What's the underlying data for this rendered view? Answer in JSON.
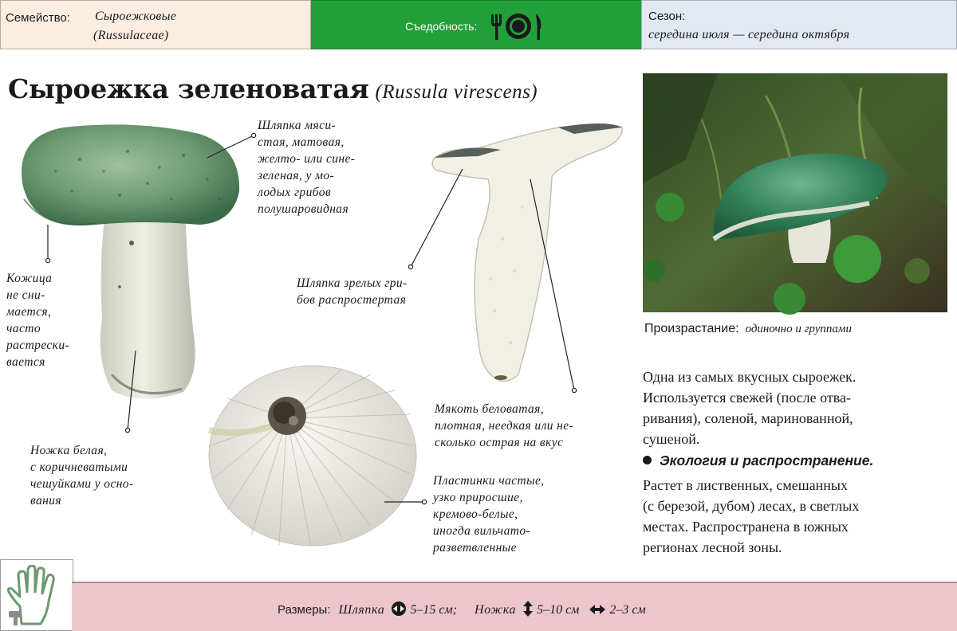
{
  "header": {
    "family_label": "Семейство:",
    "family_ru": "Сыроежковые",
    "family_lat": "(Russulaceae)",
    "edibility_label": "Съедобность:",
    "edibility_icon": "plate-fork-knife-icon",
    "season_label": "Сезон:",
    "season_value": "середина июля — середина октября"
  },
  "title": {
    "name_ru": "Сыроежка зеленоватая",
    "name_lat": "(Russula virescens)"
  },
  "annotations": {
    "cap": [
      "Шляпка мяси-",
      "стая, матовая,",
      "желто- или сине-",
      "зеленая, у мо-",
      "лодых грибов",
      "полушаровидная"
    ],
    "skin": [
      "Кожица",
      "не сни-",
      "мается,",
      "часто",
      "растрески-",
      "вается"
    ],
    "stem": [
      "Ножка белая,",
      "с коричневатыми",
      "чешуйками у осно-",
      "вания"
    ],
    "mature_cap": [
      "Шляпка зрелых гри-",
      "бов распростертая"
    ],
    "flesh": [
      "Мякоть беловатая,",
      "плотная, неедкая или не-",
      "сколько острая на вкус"
    ],
    "gills": [
      "Пластинки частые,",
      "узко приросшие,",
      "кремово-белые,",
      "иногда вильчато-",
      "разветвленные"
    ]
  },
  "habitat": {
    "label": "Произрастание:",
    "value": "одиночно и группами"
  },
  "description": [
    "Одна из самых вкусных сыроежек.",
    "Используется свежей (после отва-",
    "ривания), соленой, маринованной,",
    "сушеной."
  ],
  "ecology": {
    "heading": "Экология и распространение.",
    "text": [
      "Растет в лиственных, смешанных",
      "(с березой, дубом) лесах, в светлых",
      "местах. Распространена в южных",
      "регионах лесной зоны."
    ]
  },
  "sizes": {
    "label": "Размеры:",
    "cap_label": "Шляпка",
    "cap_value": "5–15 см;",
    "stem_label": "Ножка",
    "stem_length": "5–10 см",
    "stem_width": "2–3 см"
  },
  "colors": {
    "family_bg": "#fbeee1",
    "edibility_bg": "#22a03a",
    "season_bg": "#e3e9f3",
    "footer_bg": "#ecc6cc"
  }
}
